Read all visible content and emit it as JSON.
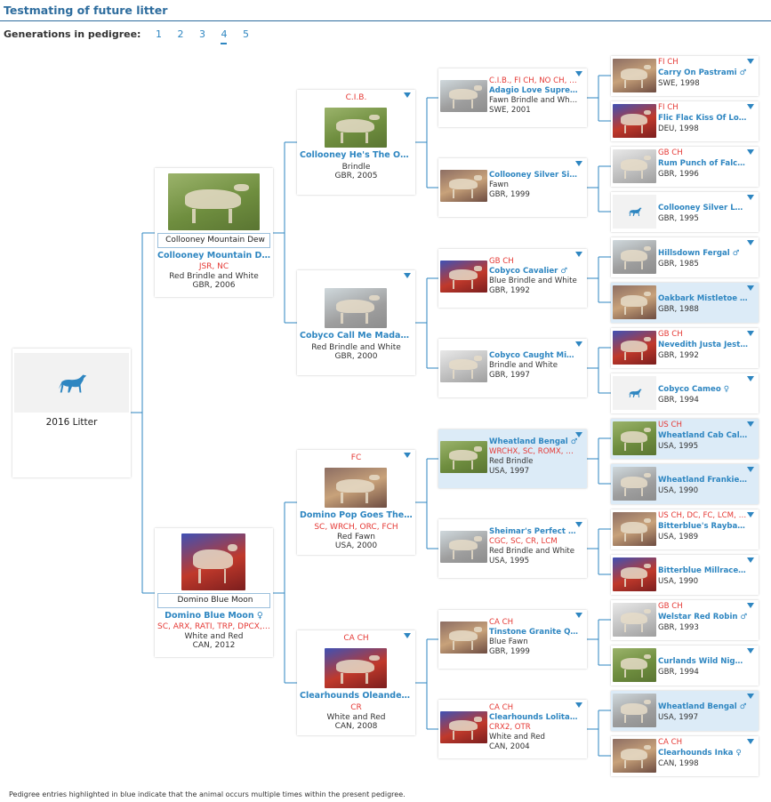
{
  "page": {
    "title": "Testmating of future litter",
    "generations_label": "Generations in pedigree:",
    "generations": [
      "1",
      "2",
      "3",
      "4",
      "5"
    ],
    "generations_active": "4",
    "footnote": "Pedigree entries highlighted in blue indicate that the animal occurs multiple times within the present pedigree."
  },
  "litter": {
    "label": "2016 Litter",
    "icon": "greyhound-icon"
  },
  "sire": {
    "input": "Collooney Mountain Dew",
    "name": "Collooney Mountain Dew ♂",
    "titles": "JSR, NC",
    "color": "Red Brindle and White",
    "origin": "GBR, 2006"
  },
  "dam": {
    "input": "Domino Blue Moon",
    "name": "Domino Blue Moon ♀",
    "titles": "SC, ARX, RATI, TRP, DPCX, PR, S...",
    "color": "White and Red",
    "origin": "CAN, 2012"
  },
  "gen2": [
    {
      "top": "C.I.B.",
      "name": "Collooney He's The One ♂",
      "titles": "",
      "color": "Brindle",
      "origin": "GBR, 2005"
    },
    {
      "top": "",
      "name": "Cobyco Call Me Madam at ...",
      "titles": "",
      "color": "Red Brindle and White",
      "origin": "GBR, 2000"
    },
    {
      "top": "FC",
      "name": "Domino Pop Goes The We...",
      "titles": "SC, WRCH, ORC, FCH",
      "color": "Red Fawn",
      "origin": "USA, 2000"
    },
    {
      "top": "CA CH",
      "name": "Clearhounds Oleander ♀",
      "titles": "CR",
      "color": "White and Red",
      "origin": "CAN, 2008"
    }
  ],
  "gen3": [
    {
      "title": "C.I.B., FI CH, NO CH, S...",
      "name": "Adagio Love Supreme...",
      "sub": "",
      "color": "Fawn Brindle and White",
      "origin": "SWE, 2001",
      "hl": false
    },
    {
      "title": "",
      "name": "Collooney Silver Silas ...",
      "sub": "",
      "color": "Fawn",
      "origin": "GBR, 1999",
      "hl": false
    },
    {
      "title": "GB CH",
      "name": "Cobyco Cavalier ♂",
      "sub": "",
      "color": "Blue Brindle and White",
      "origin": "GBR, 1992",
      "hl": false
    },
    {
      "title": "",
      "name": "Cobyco Caught Misbe...",
      "sub": "",
      "color": "Brindle and White",
      "origin": "GBR, 1997",
      "hl": false
    },
    {
      "title": "",
      "name": "Wheatland Bengal ♂",
      "sub": "WRCHX, SC, ROMX, SOR...",
      "color": "Red Brindle",
      "origin": "USA, 1997",
      "hl": true
    },
    {
      "title": "",
      "name": "Sheimar's Perfect Ali...",
      "sub": "CGC, SC, CR, LCM",
      "color": "Red Brindle and White",
      "origin": "USA, 1995",
      "hl": false
    },
    {
      "title": "CA CH",
      "name": "Tinstone Granite Quo...",
      "sub": "",
      "color": "Blue Fawn",
      "origin": "GBR, 1999",
      "hl": false
    },
    {
      "title": "CA CH",
      "name": "Clearhounds Lolita ♀",
      "sub": "CRX2, OTR",
      "color": "White and Red",
      "origin": "CAN, 2004",
      "hl": false
    }
  ],
  "gen4": [
    {
      "title": "FI CH",
      "name": "Carry On Pastrami ♂",
      "origin": "SWE, 1998",
      "hl": false,
      "photo": true
    },
    {
      "title": "FI CH",
      "name": "Flic Flac Kiss Of Love ♀",
      "origin": "DEU, 1998",
      "hl": false,
      "photo": true
    },
    {
      "title": "GB CH",
      "name": "Rum Punch of Falconc...",
      "origin": "GBR, 1996",
      "hl": false,
      "photo": true
    },
    {
      "title": "",
      "name": "Collooney Silver Lace ♀",
      "origin": "GBR, 1995",
      "hl": false,
      "photo": false
    },
    {
      "title": "",
      "name": "Hillsdown Fergal ♂",
      "origin": "GBR, 1985",
      "hl": false,
      "photo": true
    },
    {
      "title": "",
      "name": "Oakbark Mistletoe An...",
      "origin": "GBR, 1988",
      "hl": true,
      "photo": true
    },
    {
      "title": "GB CH",
      "name": "Nevedith Justa Jesta ♂",
      "origin": "GBR, 1992",
      "hl": false,
      "photo": true
    },
    {
      "title": "",
      "name": "Cobyco Cameo ♀",
      "origin": "GBR, 1994",
      "hl": false,
      "photo": false
    },
    {
      "title": "US CH",
      "name": "Wheatland Cab Callo...",
      "origin": "USA, 1995",
      "hl": true,
      "photo": true
    },
    {
      "title": "",
      "name": "Wheatland Frankie Su...",
      "origin": "USA, 1990",
      "hl": true,
      "photo": true
    },
    {
      "title": "US CH, DC, FC, LCM, FCH",
      "name": "Bitterblue's Raybar Pe...",
      "origin": "USA, 1989",
      "hl": false,
      "photo": true
    },
    {
      "title": "",
      "name": "Bitterblue Millrace Ma...",
      "origin": "USA, 1990",
      "hl": false,
      "photo": true
    },
    {
      "title": "GB CH",
      "name": "Welstar Red Robin ♂",
      "origin": "GBR, 1993",
      "hl": false,
      "photo": true
    },
    {
      "title": "",
      "name": "Curlands Wild Nights ...",
      "origin": "GBR, 1994",
      "hl": false,
      "photo": true
    },
    {
      "title": "",
      "name": "Wheatland Bengal ♂",
      "origin": "USA, 1997",
      "hl": true,
      "photo": true
    },
    {
      "title": "CA CH",
      "name": "Clearhounds Inka ♀",
      "origin": "CAN, 1998",
      "hl": false,
      "photo": true
    }
  ],
  "colors": {
    "accent": "#2e86c1",
    "title_blue": "#2e6d9e",
    "highlight": "#dcebf7",
    "red_title": "#e53935",
    "line": "#2e86c1"
  }
}
